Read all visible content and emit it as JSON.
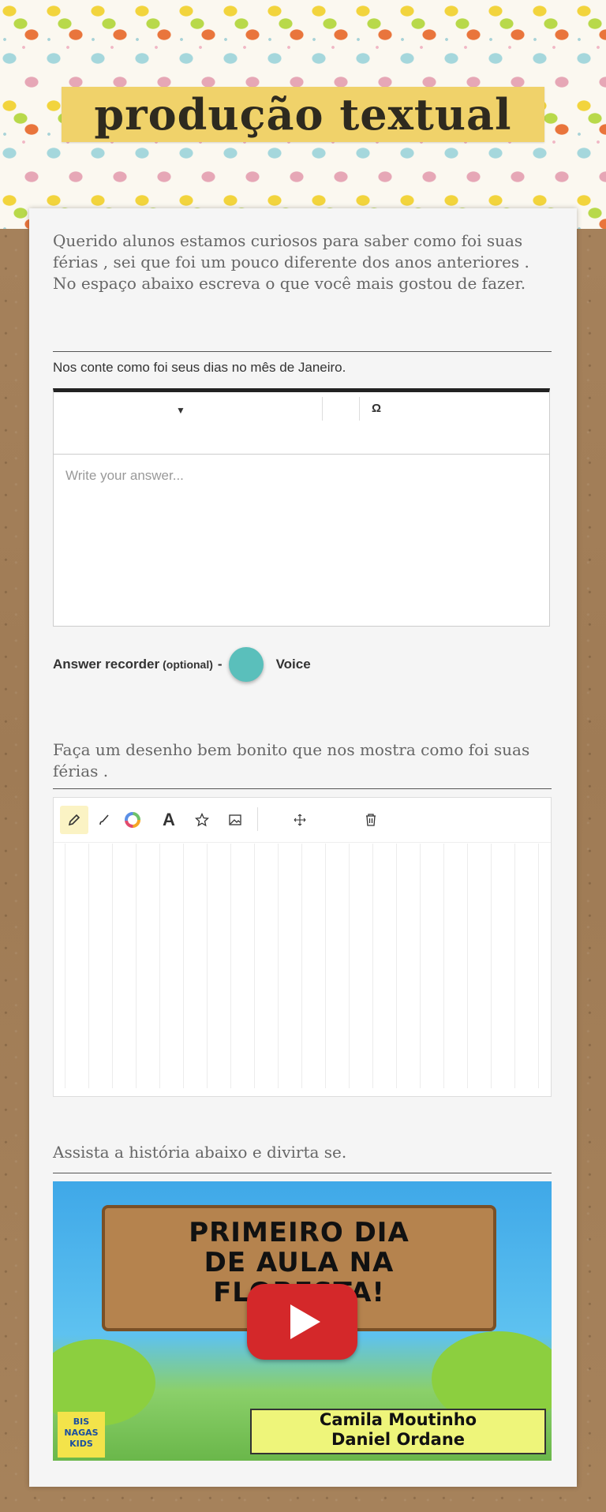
{
  "header": {
    "title": "produção textual"
  },
  "intro": "Querido  alunos estamos curiosos para saber como foi suas férias , sei que foi um pouco diferente dos anos anteriores . No espaço abaixo escreva o que você mais gostou de fazer.",
  "question1": {
    "label": "Nos conte como foi seus dias no mês de Janeiro.",
    "toolbar": {
      "omega": "Ω"
    },
    "placeholder": "Write your answer..."
  },
  "recorder": {
    "label": "Answer recorder",
    "optional": "(optional)",
    "dash": "-",
    "voice": "Voice",
    "button_color": "#5abfbb"
  },
  "question2": {
    "prompt": "Faça  um desenho bem bonito  que nos mostra como foi suas férias .",
    "tools": [
      "pencil-icon",
      "brush-icon",
      "color-wheel-icon",
      "text-icon",
      "star-icon",
      "image-icon",
      "move-icon",
      "trash-icon"
    ],
    "text_tool_glyph": "A"
  },
  "question3": {
    "prompt": "Assista a história abaixo e divirta se.",
    "video": {
      "title_lines": [
        "PRIMEIRO DIA",
        "DE AULA NA",
        "FLORESTA!"
      ],
      "authors": [
        "Camila Moutinho",
        "Daniel Ordane"
      ],
      "publisher": [
        "BIS",
        "NAGAS",
        "KIDS"
      ]
    }
  },
  "colors": {
    "title_band": "#f0d26a",
    "play_button": "#d4282a",
    "card": "#f5f5f5"
  }
}
